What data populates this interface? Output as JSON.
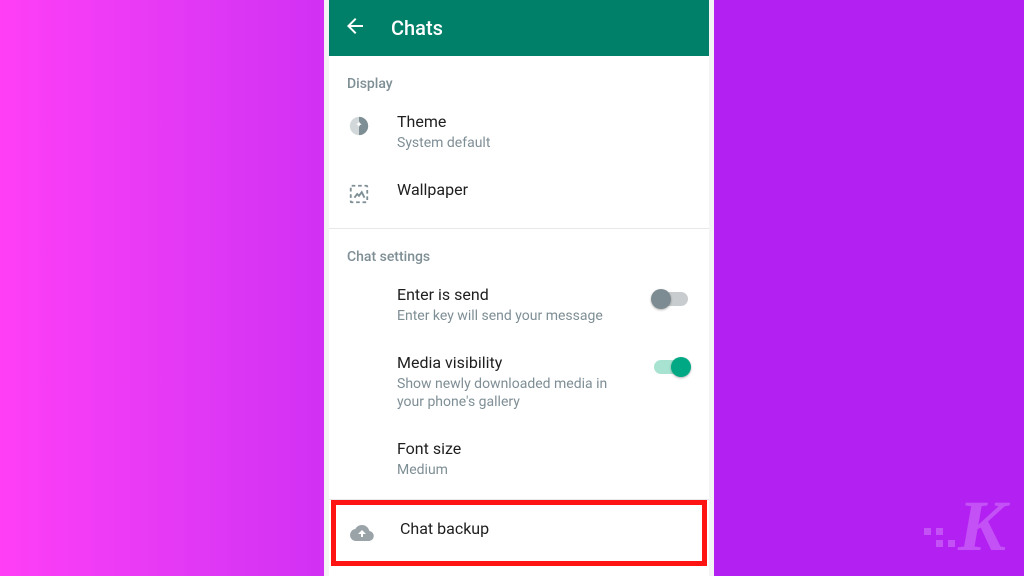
{
  "header": {
    "title": "Chats"
  },
  "sections": {
    "display": {
      "header": "Display",
      "theme": {
        "label": "Theme",
        "value": "System default"
      },
      "wallpaper": {
        "label": "Wallpaper"
      }
    },
    "chat_settings": {
      "header": "Chat settings",
      "enter_is_send": {
        "label": "Enter is send",
        "desc": "Enter key will send your message",
        "toggle": false
      },
      "media_visibility": {
        "label": "Media visibility",
        "desc": "Show newly downloaded media in your phone's gallery",
        "toggle": true
      },
      "font_size": {
        "label": "Font size",
        "value": "Medium"
      },
      "chat_backup": {
        "label": "Chat backup"
      }
    }
  },
  "colors": {
    "app_bar": "#008069",
    "accent": "#00a884",
    "highlight": "#ff1414"
  }
}
